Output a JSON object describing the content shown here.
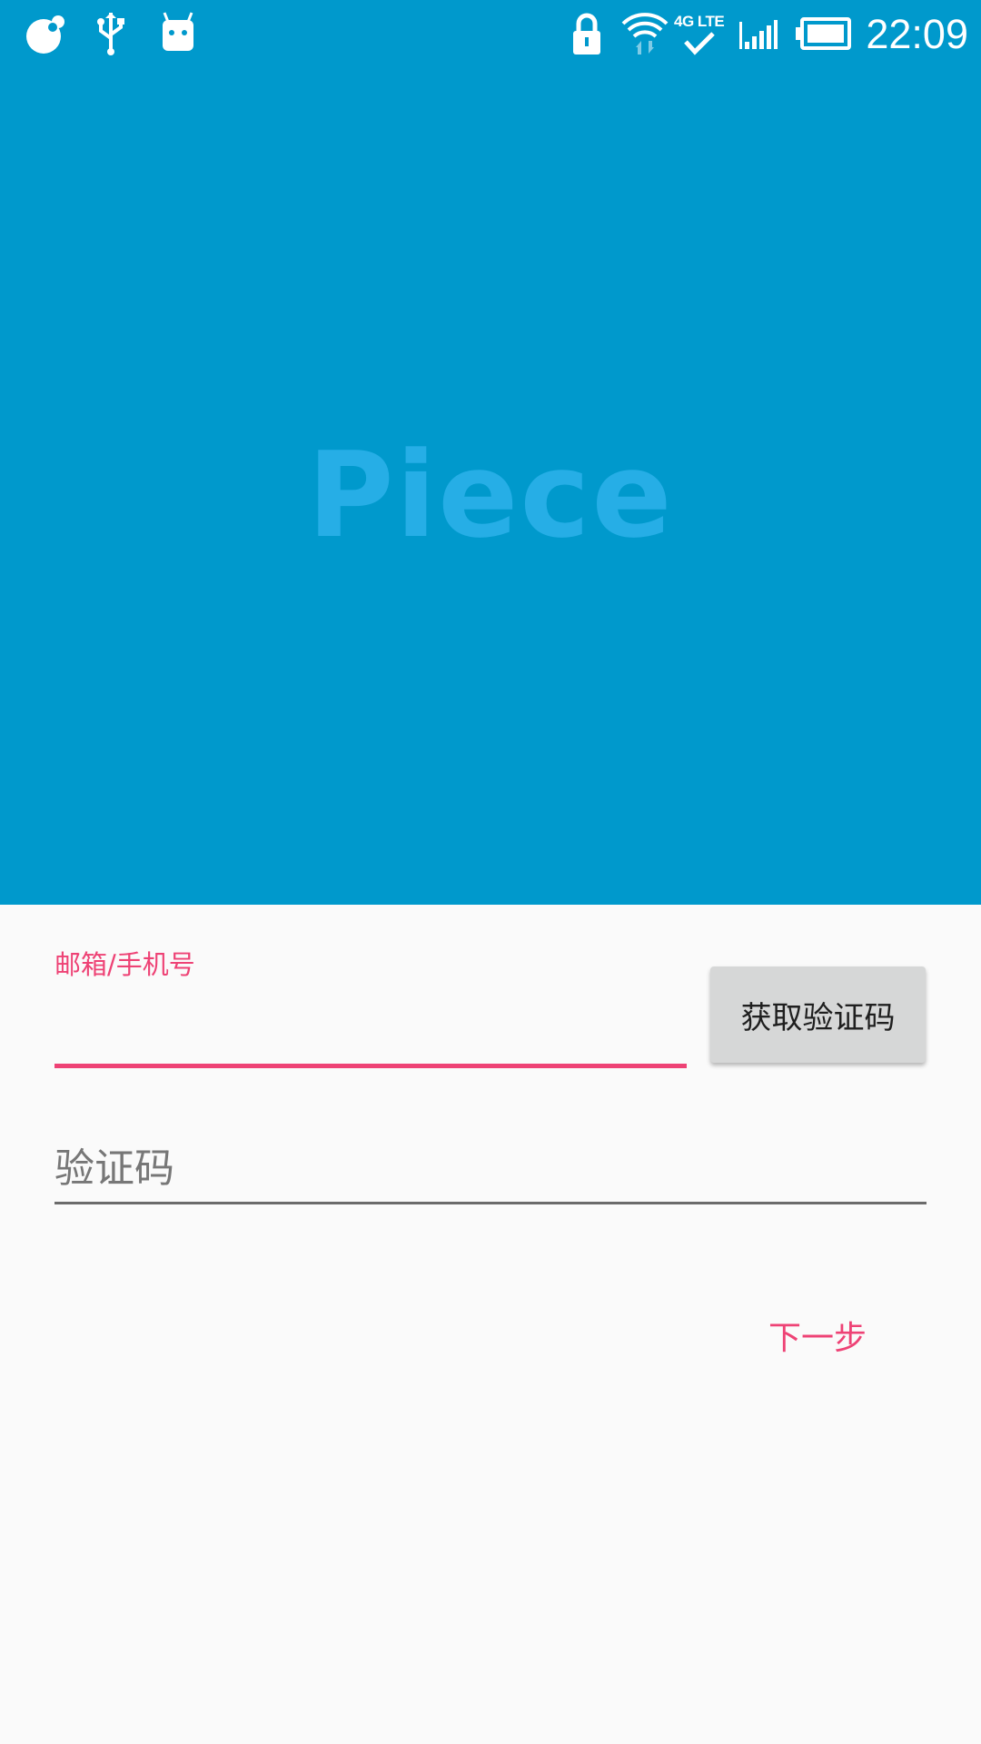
{
  "status_bar": {
    "time": "22:09",
    "network_label": "4G LTE",
    "icons": [
      "notification-blob-icon",
      "usb-icon",
      "android-icon",
      "lock-icon",
      "wifi-icon",
      "check-icon",
      "signal-icon",
      "battery-icon"
    ]
  },
  "header": {
    "brand": "Piece"
  },
  "form": {
    "account_label": "邮箱/手机号",
    "account_value": "",
    "get_code_label": "获取验证码",
    "code_placeholder": "验证码",
    "code_value": "",
    "next_label": "下一步"
  },
  "colors": {
    "header_bg": "#0099cc",
    "brand_text": "#26aee6",
    "accent": "#ee4275",
    "page_bg": "#fafafa",
    "button_bg": "#d6d7d7"
  }
}
